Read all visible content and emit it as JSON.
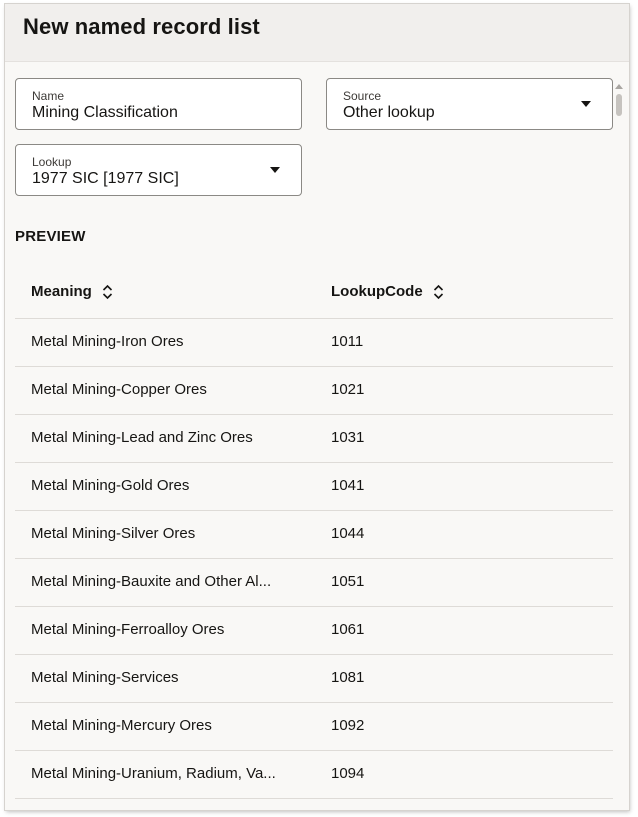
{
  "dialog": {
    "title": "New named record list"
  },
  "form": {
    "name": {
      "label": "Name",
      "value": "Mining Classification"
    },
    "source": {
      "label": "Source",
      "value": "Other lookup"
    },
    "lookup": {
      "label": "Lookup",
      "value": "1977 SIC [1977 SIC]"
    }
  },
  "preview": {
    "heading": "PREVIEW",
    "columns": [
      "Meaning",
      "LookupCode"
    ],
    "rows": [
      {
        "meaning": "Metal Mining-Iron Ores",
        "code": "1011"
      },
      {
        "meaning": "Metal Mining-Copper Ores",
        "code": "1021"
      },
      {
        "meaning": "Metal Mining-Lead and Zinc Ores",
        "code": "1031"
      },
      {
        "meaning": "Metal Mining-Gold Ores",
        "code": "1041"
      },
      {
        "meaning": "Metal Mining-Silver Ores",
        "code": "1044"
      },
      {
        "meaning": "Metal Mining-Bauxite and Other Al...",
        "code": "1051"
      },
      {
        "meaning": "Metal Mining-Ferroalloy Ores",
        "code": "1061"
      },
      {
        "meaning": "Metal Mining-Services",
        "code": "1081"
      },
      {
        "meaning": "Metal Mining-Mercury Ores",
        "code": "1092"
      },
      {
        "meaning": "Metal Mining-Uranium, Radium, Va...",
        "code": "1094"
      }
    ]
  },
  "icons": {
    "sort": "sort-up-down-icon",
    "dropdown": "caret-down-icon"
  }
}
